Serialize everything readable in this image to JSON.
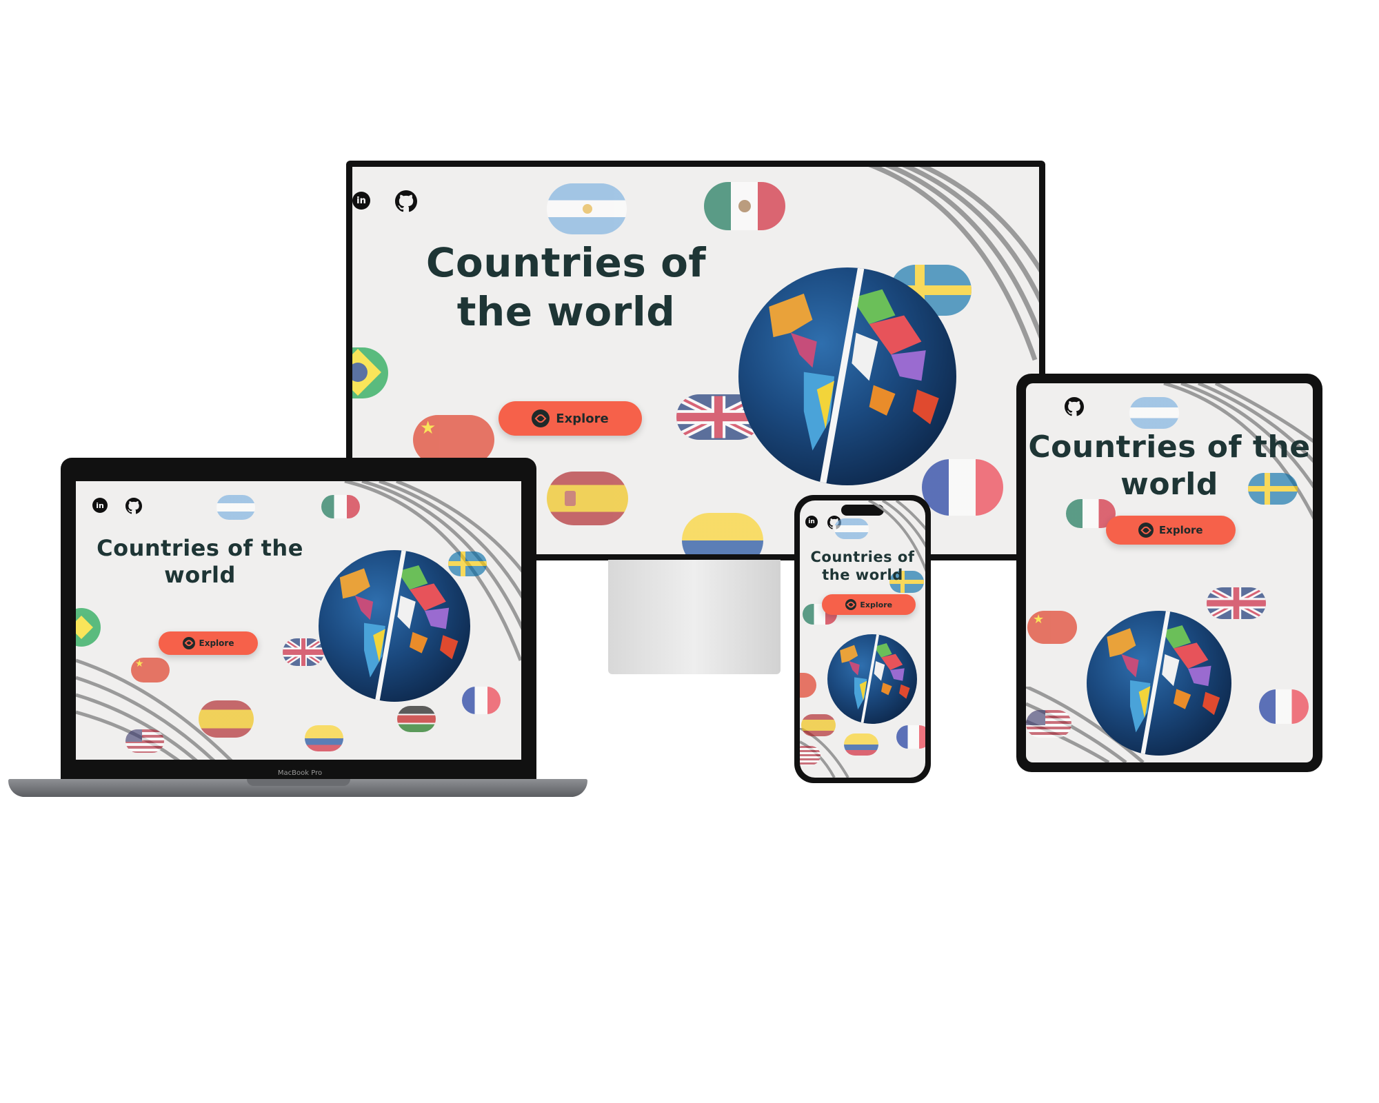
{
  "app": {
    "title": "Countries of the world",
    "explore_label": "Explore",
    "social": {
      "linkedin_text": "in"
    }
  },
  "devices": {
    "laptop_brand": "MacBook Pro"
  },
  "colors": {
    "background": "#f0efee",
    "title": "#1e3535",
    "button": "#f6614a",
    "bezel": "#111111",
    "stripes": "#9a9a9a"
  },
  "icons": [
    "linkedin-icon",
    "github-icon",
    "compass-icon",
    "globe-image"
  ],
  "flags": [
    "argentina",
    "mexico",
    "sweden",
    "brazil",
    "china",
    "united-kingdom",
    "spain",
    "france",
    "colombia",
    "kenya",
    "united-states"
  ]
}
